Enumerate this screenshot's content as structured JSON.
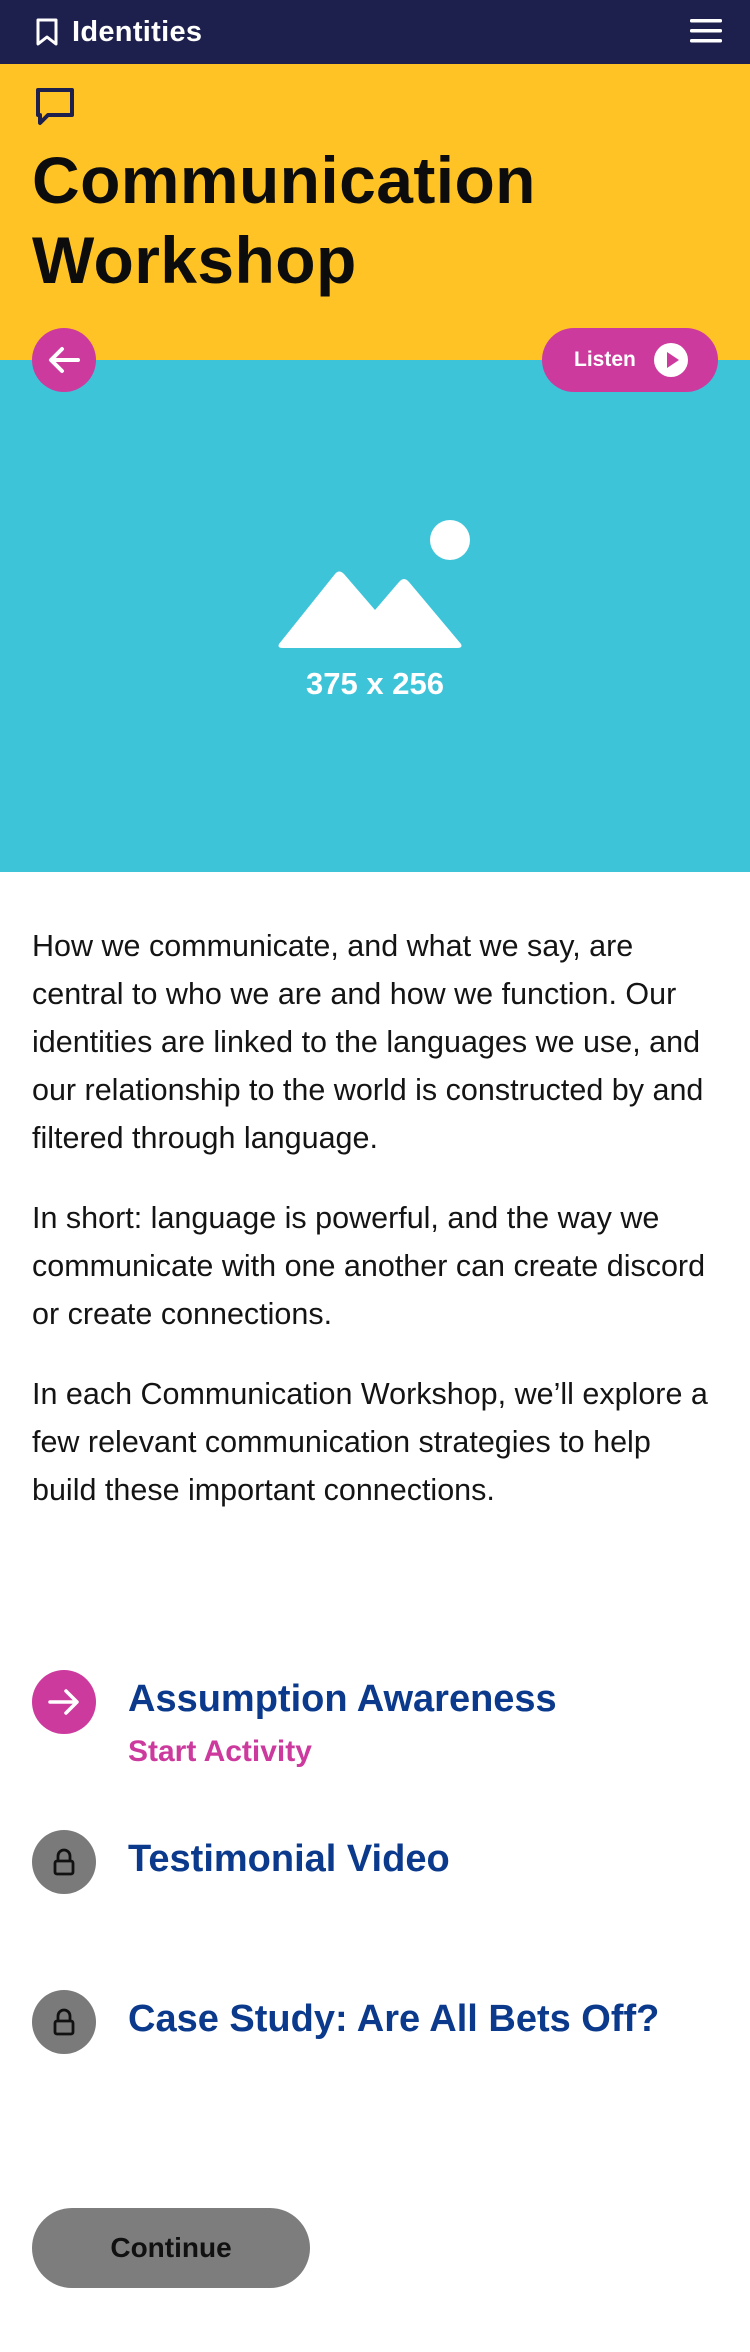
{
  "header": {
    "app_title": "Identities",
    "bookmark_icon": "bookmark-icon",
    "menu_icon": "hamburger-menu-icon"
  },
  "hero": {
    "icon": "speech-bubble-icon",
    "title": "Communication Workshop",
    "background": "#ffc325"
  },
  "controls": {
    "back_icon": "arrow-left-icon",
    "listen_label": "Listen",
    "play_icon": "play-icon"
  },
  "banner": {
    "icon": "image-placeholder-icon",
    "dimensions_label": "375 x 256",
    "background": "#3ec4d8"
  },
  "intro": {
    "paragraphs": [
      "How we communicate, and what we say, are central to who we are and how we function. Our identities are linked to the languages we use, and our relationship to the world is constructed by and filtered through language.",
      "In short: language is powerful, and the way we communicate with one another can create discord or create connections.",
      "In each Communication Workshop, we’ll explore a few relevant communication strategies to help build these important connections."
    ]
  },
  "activities": [
    {
      "title": "Assumption Awareness",
      "action": "Start Activity",
      "state": "available",
      "icon": "arrow-right-icon"
    },
    {
      "title": "Testimonial Video",
      "state": "locked",
      "icon": "lock-icon"
    },
    {
      "title": "Case Study: Are All Bets Off?",
      "state": "locked",
      "icon": "lock-icon"
    }
  ],
  "footer": {
    "continue_label": "Continue"
  },
  "colors": {
    "navy_bar": "#1d1f4d",
    "accent_pink": "#cc3a9e",
    "activity_title": "#0b3a8c",
    "locked_grey": "#7a7a7a"
  }
}
